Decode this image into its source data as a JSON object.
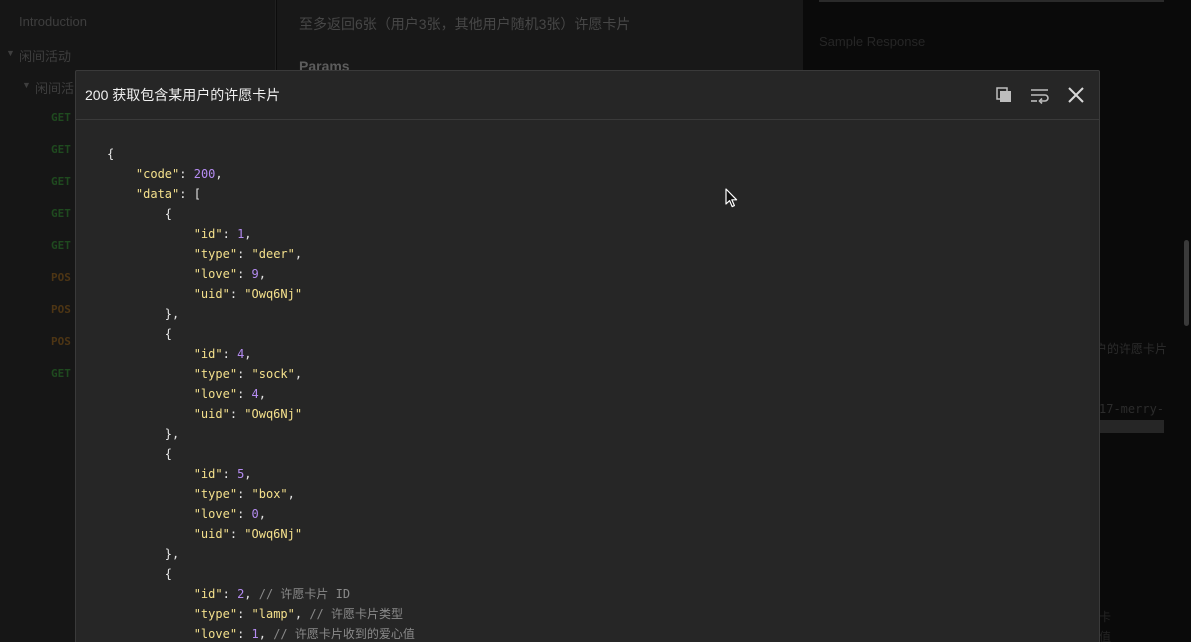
{
  "sidebar": {
    "introduction": "Introduction",
    "group1": "闲间活动",
    "group2": "闲间活",
    "methods": [
      "GET",
      "GET",
      "GET",
      "GET",
      "GET",
      "POS",
      "POS",
      "POS",
      "GET"
    ]
  },
  "main": {
    "description": "至多返回6张（用户3张，其他用户随机3张）许愿卡片",
    "params_heading": "Params"
  },
  "right_panel": {
    "sample_response": "Sample Response",
    "fragment_1": "户的许愿卡片",
    "fragment_2": "17-merry-",
    "fragment_3": "卡",
    "fragment_4": "值"
  },
  "modal": {
    "title": "200 获取包含某用户的许愿卡片",
    "icons": [
      "copy-icon",
      "wrap-icon",
      "close-icon"
    ],
    "code": {
      "code_key": "\"code\"",
      "code_val": "200",
      "data_key": "\"data\"",
      "keys": {
        "id": "\"id\"",
        "type": "\"type\"",
        "love": "\"love\"",
        "uid": "\"uid\""
      },
      "items": [
        {
          "id": "1",
          "type": "\"deer\"",
          "love": "9",
          "uid": "\"Owq6Nj\""
        },
        {
          "id": "4",
          "type": "\"sock\"",
          "love": "4",
          "uid": "\"Owq6Nj\""
        },
        {
          "id": "5",
          "type": "\"box\"",
          "love": "0",
          "uid": "\"Owq6Nj\""
        },
        {
          "id": "2",
          "type": "\"lamp\"",
          "love": "1"
        }
      ],
      "comments": {
        "id": "// 许愿卡片 ID",
        "type": "// 许愿卡片类型",
        "love": "// 许愿卡片收到的爱心值"
      }
    }
  }
}
